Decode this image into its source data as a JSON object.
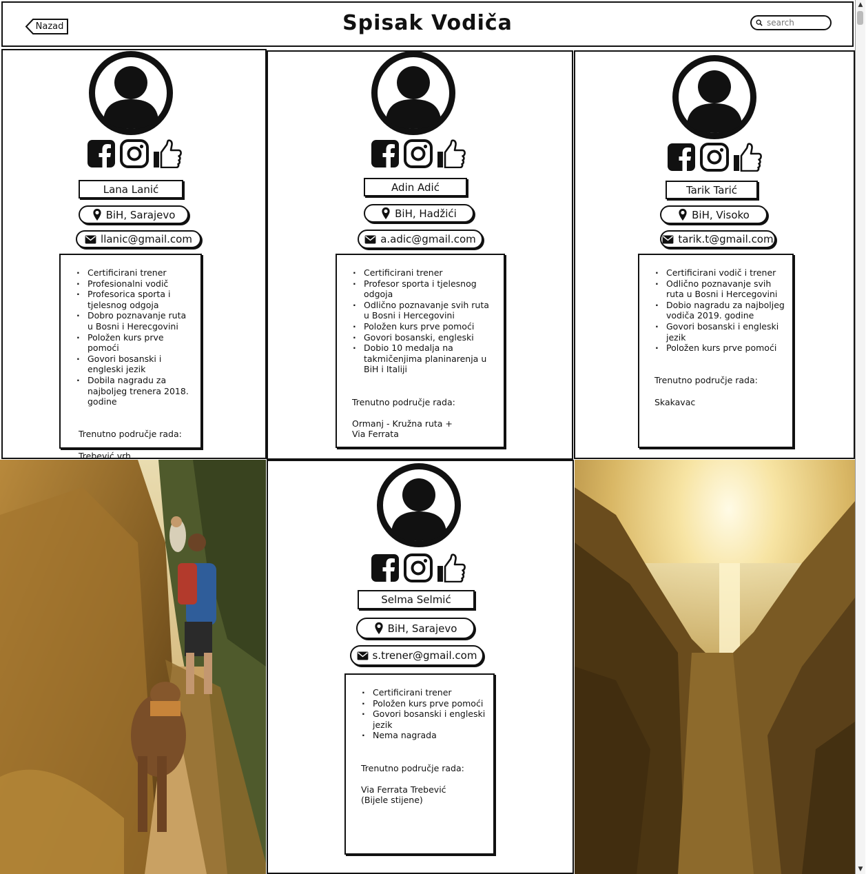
{
  "header": {
    "back_label": "Nazad",
    "title": "Spisak Vodiča",
    "search_placeholder": "search"
  },
  "guides": [
    {
      "name": "Lana Lanić",
      "location": "BiH, Sarajevo",
      "email": "llanic@gmail.com",
      "bullets": [
        "Certificirani trener",
        "Profesionalni vodič",
        "Profesorica sporta i tjelesnog odgoja",
        "Dobro poznavanje ruta u Bosni i Herecgovini",
        "Položen kurs prve pomoći",
        "Govori bosanski i engleski jezik",
        "Dobila nagradu za najboljeg trenera 2018. godine"
      ],
      "area_label": "Trenutno područje rada:",
      "area_value": "Trebević vrh"
    },
    {
      "name": "Adin Adić",
      "location": "BiH, Hadžići",
      "email": "a.adic@gmail.com",
      "bullets": [
        "Certificirani trener",
        "Profesor sporta i tjelesnog odgoja",
        "Odlično poznavanje svih ruta u Bosni i Hercegovini",
        "Položen kurs prve pomoći",
        "Govori bosanski, engleski",
        "Dobio 10 medalja na takmičenjima planinarenja u BiH i Italiji"
      ],
      "area_label": "Trenutno područje rada:",
      "area_value": "Ormanj - Kružna ruta +\nVia Ferrata"
    },
    {
      "name": "Tarik Tarić",
      "location": "BiH, Visoko",
      "email": "tarik.t@gmail.com",
      "bullets": [
        "Certificirani vodič i trener",
        "Odlično poznavanje svih ruta u Bosni i Hercegovini",
        "Dobio nagradu za najboljeg vodiča 2019. godine",
        "Govori bosanski i engleski jezik",
        "Položen kurs prve pomoći"
      ],
      "area_label": "Trenutno područje rada:",
      "area_value": "Skakavac"
    },
    {
      "name": "Selma Selmić",
      "location": "BiH, Sarajevo",
      "email": "s.trener@gmail.com",
      "bullets": [
        "Certificirani trener",
        "Položen kurs prve pomoći",
        "Govori bosanski i engleski jezik",
        "Nema nagrada"
      ],
      "area_label": "Trenutno područje rada:",
      "area_value": " Via Ferrata Trebević\n (Bijele stijene)"
    }
  ],
  "icons": {
    "facebook": "facebook-icon",
    "instagram": "instagram-icon",
    "like": "thumbs-up-icon",
    "location": "map-pin-icon",
    "email": "envelope-icon",
    "search": "search-icon",
    "avatar": "user-avatar-icon"
  }
}
